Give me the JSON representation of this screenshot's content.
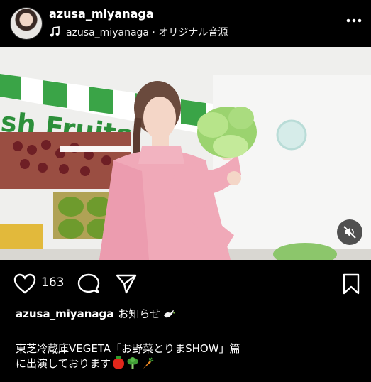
{
  "post": {
    "username": "azusa_miyanaga",
    "audio": "azusa_miyanaga · オリジナル音源"
  },
  "media": {
    "scene_sign": "sh Fruits",
    "description_icons": [
      "video-frame",
      "mute-icon"
    ]
  },
  "actions": {
    "like_count": "163"
  },
  "caption": {
    "username": "azusa_miyanaga",
    "title": "お知らせ",
    "line1": "東芝冷蔵庫VEGETA「お野菜とりまSHOW」篇",
    "line2": "に出演しております"
  },
  "colors": {
    "background": "#000000",
    "text": "#ffffff",
    "mute_button_bg": "#323232"
  }
}
